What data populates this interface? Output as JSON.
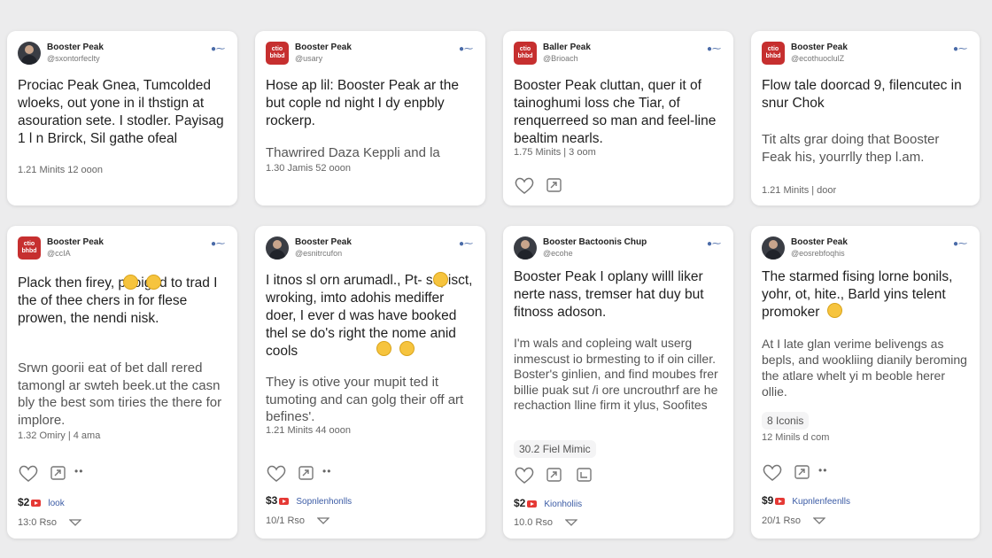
{
  "cards": [
    {
      "author": "Booster Peak",
      "handle": "@sxontorfeclty",
      "avatar": "person-avatar",
      "body": "Prociac Peak Gnea, Tumcolded wloeks, out yone in il thstign at asouration sete. I stodler. Payisag 1 l n Brirck, Sil gathe ofeal",
      "meta": "1.21 Minits  12 ooon"
    },
    {
      "author": "Booster Peak",
      "handle": "@usary",
      "avatar": "brand-logo",
      "logo_text": "ctio\nbhbd",
      "body": "Hose ap lil: Booster Peak ar the but cople nd night I dy enpbly rockerp.",
      "sub": "Thawrired Daza Keppli and la",
      "meta": "1.30 Jamis  52 ooon"
    },
    {
      "author": "Baller Peak",
      "handle": "@Brioach",
      "avatar": "brand-logo",
      "logo_text": "ctio\nbhbd",
      "body": "Booster Peak cluttan, quer it of tainoghumi loss che Tiar, of renquerreed so man and feel-line bealtim nearls.",
      "meta": "1.75 Minits  | 3 oom"
    },
    {
      "author": "Booster Peak",
      "handle": "@ecothuoclulZ",
      "avatar": "brand-logo",
      "logo_text": "ctio\nbhbd",
      "body": "Flow tale doorcad 9, filencutec in snur Chok",
      "sub": "Tit alts grar doing that Booster Feak his, yourrlly thep l.am.",
      "meta": "1.21 Minits  |  door"
    },
    {
      "author": "Booster Peak",
      "handle": "@ccIA",
      "avatar": "brand-logo",
      "logo_text": "ctio\nbhbd",
      "body": "Plack then firey,   paoignd to trad I the of thee chers in for flese prowen, the nendi nisk.",
      "sub": "Srwn goorii eat of bet dall rered tamongl ar swteh beek.ut the casn bly the best som tiries the there for implore.",
      "meta": "1.32 Omiry  | 4 ama",
      "price": "$2",
      "link": "look",
      "foot": "13:0 Rso"
    },
    {
      "author": "Booster Peak",
      "handle": "@esnitrcufon",
      "avatar": "person-avatar",
      "body": "I itnos sl orn arumadl., Pt- supisct, wroking, imto adohis mediffer doer, I ever d was have booked thel se do's right the nome anid cools",
      "sub": "They is otive your mupit ted it tumoting and can golg their off art befines'.",
      "meta": "1.21 Minits  44 ooon",
      "price": "$3",
      "link": "Sopnlenhonlls",
      "foot": "10/1 Rso"
    },
    {
      "author": "Booster Bactoonis Chup",
      "handle": "@ecohe",
      "avatar": "person-avatar",
      "body": "Booster Peak I oplany willl liker nerte nass, tremser hat duy but fitnoss adoson.",
      "sub": "I'm wals and copleing walt userg inmescust io brmesting to if oin ciller. Boster's ginlien, and find moubes frer billie puak sut /i ore uncrouthrf are he rechaction lline firm it ylus, Soofites",
      "pill": "30.2 Fiel Mimic",
      "price": "$2",
      "link": "Kionholiis",
      "foot": "10.0 Rso"
    },
    {
      "author": "Booster Peak",
      "handle": "@eosrebfoqhis",
      "avatar": "person-avatar",
      "body": "The starmed fising lorne bonils, yohr, ot, hite., Barld yins telent promoker",
      "sub": "At I late glan verime belivengs as bepls, and wookliing dianily beroming the atlare whelt yi m beoble herer ollie.",
      "pill": "8 Iconis",
      "meta": "12 Minils d com",
      "price": "$9",
      "link": "Kupnlenfeenlls",
      "foot": "20/1 Rso"
    }
  ],
  "colors": {
    "background": "#ececed",
    "card": "#ffffff",
    "logo": "#c62f2f",
    "accent": "#3b5ba5",
    "youtube": "#e53935"
  }
}
